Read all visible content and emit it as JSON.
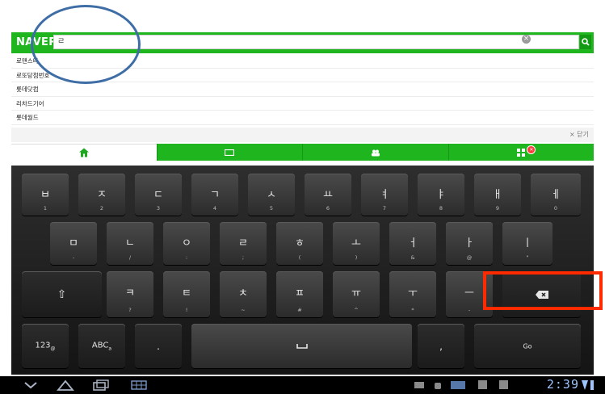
{
  "search": {
    "logo": "NAVER",
    "value": "ㄹ"
  },
  "suggestions": [
    "로맨스타",
    "로또당첨번호",
    "롯데닷컴",
    "리차드기어",
    "롯데월드"
  ],
  "close_label": "× 닫기",
  "tabs": [
    {
      "name": "home",
      "icon": "home-icon"
    },
    {
      "name": "window",
      "icon": "window-icon"
    },
    {
      "name": "people",
      "icon": "people-icon"
    },
    {
      "name": "more",
      "icon": "grid-icon",
      "badge": "✕"
    }
  ],
  "keyboard": {
    "row1": [
      {
        "main": "ㅂ",
        "sub": "1"
      },
      {
        "main": "ㅈ",
        "sub": "2"
      },
      {
        "main": "ㄷ",
        "sub": "3"
      },
      {
        "main": "ㄱ",
        "sub": "4"
      },
      {
        "main": "ㅅ",
        "sub": "5"
      },
      {
        "main": "ㅛ",
        "sub": "6"
      },
      {
        "main": "ㅕ",
        "sub": "7"
      },
      {
        "main": "ㅑ",
        "sub": "8"
      },
      {
        "main": "ㅐ",
        "sub": "9"
      },
      {
        "main": "ㅔ",
        "sub": "0"
      }
    ],
    "row2": [
      {
        "main": "ㅁ",
        "sub": "-"
      },
      {
        "main": "ㄴ",
        "sub": "/"
      },
      {
        "main": "ㅇ",
        "sub": ":"
      },
      {
        "main": "ㄹ",
        "sub": ";"
      },
      {
        "main": "ㅎ",
        "sub": "("
      },
      {
        "main": "ㅗ",
        "sub": ")"
      },
      {
        "main": "ㅓ",
        "sub": "&"
      },
      {
        "main": "ㅏ",
        "sub": "@"
      },
      {
        "main": "ㅣ",
        "sub": "\""
      }
    ],
    "row3": [
      {
        "main": "ㅋ",
        "sub": "?"
      },
      {
        "main": "ㅌ",
        "sub": "!"
      },
      {
        "main": "ㅊ",
        "sub": "~"
      },
      {
        "main": "ㅍ",
        "sub": "#"
      },
      {
        "main": "ㅠ",
        "sub": "^"
      },
      {
        "main": "ㅜ",
        "sub": "*"
      },
      {
        "main": "ㅡ",
        "sub": "-"
      }
    ],
    "shift": "⇧",
    "backspace": "⌫",
    "num_label": "123",
    "num_sub": "@",
    "abc_label": "ABC",
    "abc_sub": "a",
    "dot": ".",
    "space": "␣",
    "comma": ",",
    "go": "Go"
  },
  "sysbar": {
    "clock": "2:39"
  }
}
